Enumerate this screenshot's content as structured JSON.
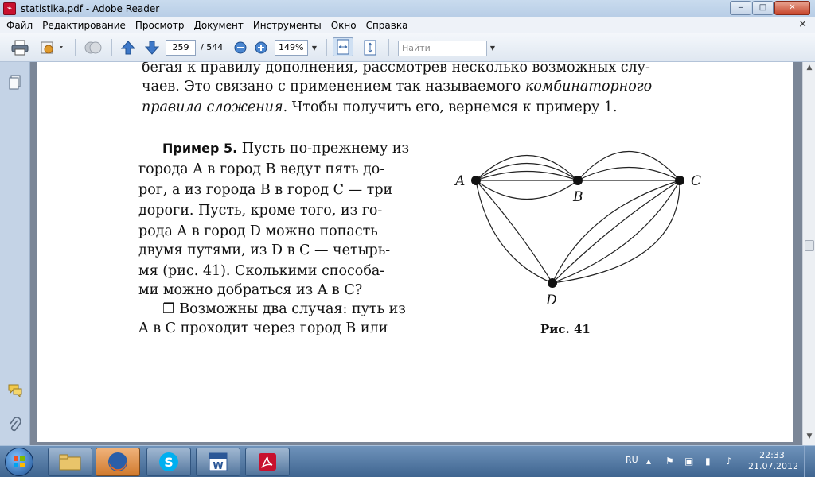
{
  "window": {
    "title": "statistika.pdf - Adobe Reader",
    "buttons": {
      "minimize": "‒",
      "maximize": "□",
      "close": "✕"
    }
  },
  "menu": {
    "items": [
      "Файл",
      "Редактирование",
      "Просмотр",
      "Документ",
      "Инструменты",
      "Окно",
      "Справка"
    ],
    "close_glyph": "×"
  },
  "toolbar": {
    "page_current": "259",
    "page_total": "/ 544",
    "zoom": "149%",
    "find_placeholder": "Найти"
  },
  "sidepanel": {
    "icons": [
      "pages-icon",
      "comments-icon",
      "attachments-icon"
    ]
  },
  "document": {
    "top_lines": [
      "бегая к правилу дополнения, рассмотрев несколько возможных слу-",
      "чаев. Это связано с применением так называемого ",
      "правила сложения",
      ". Чтобы получить его, вернемся к примеру 1."
    ],
    "top_italic_1": "комбинаторного",
    "example_label": "Пример 5.",
    "example_lines": [
      " Пусть по-прежнему из",
      "города A в город B ведут пять до-",
      "рог, а из города B в город C — три",
      "дороги. Пусть, кроме того, из го-",
      "рода A в город D можно попасть",
      "двумя путями, из D в C — четырь-",
      "мя (рис. 41). Сколькими способа-",
      "ми можно добраться из A в C?"
    ],
    "solution_lines": [
      "❐ Возможны два случая: путь из",
      "A в C проходит через город B или"
    ],
    "figure": {
      "labels": {
        "A": "A",
        "B": "B",
        "C": "C",
        "D": "D"
      },
      "caption": "Рис. 41"
    }
  },
  "taskbar": {
    "apps": [
      "explorer-icon",
      "firefox-icon",
      "skype-icon",
      "word-icon",
      "acrobat-icon"
    ],
    "language": "RU",
    "time": "22:33",
    "date": "21.07.2012"
  }
}
